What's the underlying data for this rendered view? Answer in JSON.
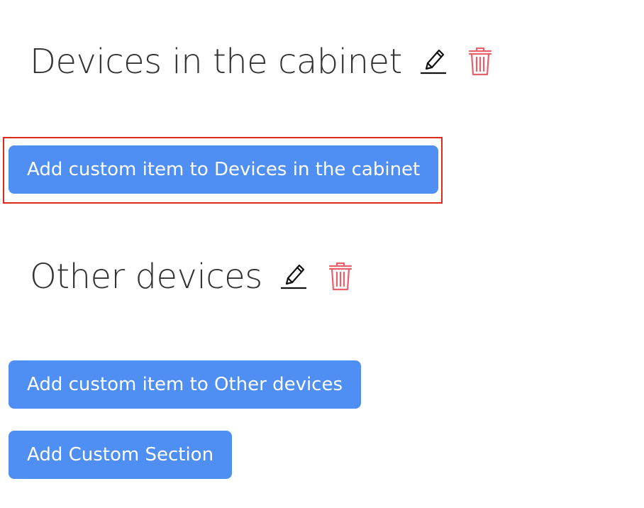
{
  "sections": [
    {
      "title": "Devices in the cabinet",
      "add_item_label": "Add custom item to Devices in the cabinet"
    },
    {
      "title": "Other devices",
      "add_item_label": "Add custom item to Other devices"
    }
  ],
  "add_section_label": "Add Custom Section",
  "icons": {
    "edit": "pencil-icon",
    "delete": "trash-icon"
  },
  "colors": {
    "button_bg": "#4f8ef3",
    "button_text": "#ffffff",
    "delete_icon": "#e8606a",
    "highlight_border": "#e02a18",
    "title_text": "#333333"
  }
}
